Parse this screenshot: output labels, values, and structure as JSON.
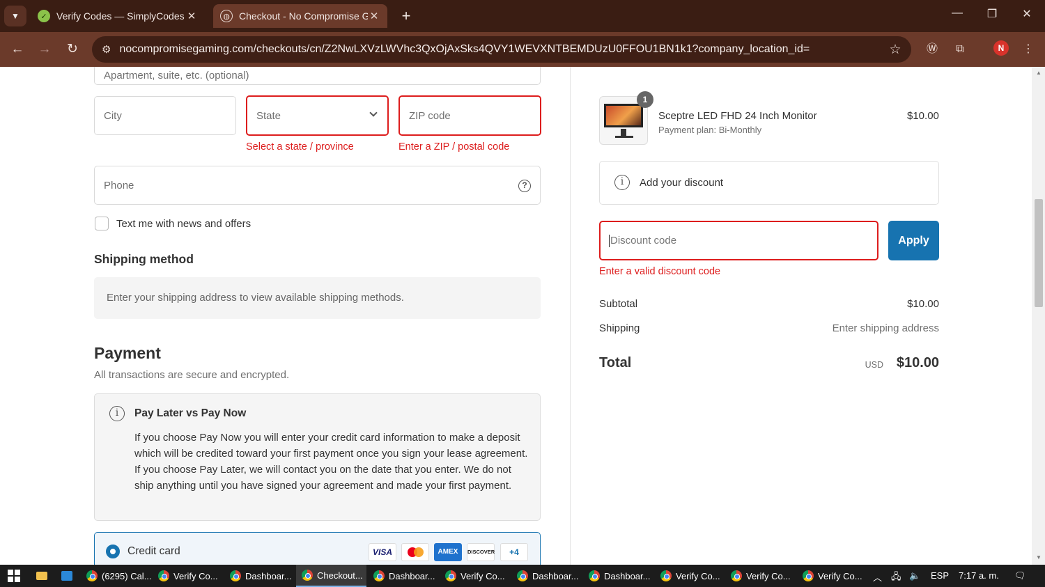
{
  "browser": {
    "tabs": [
      {
        "title": "Verify Codes — SimplyCodes",
        "active": false
      },
      {
        "title": "Checkout - No Compromise Gaming",
        "active": true
      }
    ],
    "url": "nocompromisegaming.com/checkouts/cn/Z2NwLXVzLWVhc3QxOjAxSks4QVY1WEVXNTBEMDUzU0FFOU1BN1k1?company_location_id=",
    "profile_initial": "N"
  },
  "form": {
    "apartment_placeholder": "Apartment, suite, etc. (optional)",
    "city_placeholder": "City",
    "state_placeholder": "State",
    "state_error": "Select a state / province",
    "zip_placeholder": "ZIP code",
    "zip_error": "Enter a ZIP / postal code",
    "phone_placeholder": "Phone",
    "text_offers_label": "Text me with news and offers",
    "shipping_heading": "Shipping method",
    "shipping_notice": "Enter your shipping address to view available shipping methods."
  },
  "payment": {
    "heading": "Payment",
    "subheading": "All transactions are secure and encrypted.",
    "info_title": "Pay Later vs Pay Now",
    "info_body": "If you choose Pay Now you will enter your credit card information to make a deposit which will be credited toward your first payment once you sign your lease agreement. If you choose Pay Later, we will contact you on the date that you enter. We do not ship anything until you have signed your agreement and made your first payment.",
    "credit_card_label": "Credit card",
    "card_brands": [
      "VISA",
      "",
      "AMEX",
      "DISCOVER"
    ],
    "more_cards": "+4"
  },
  "summary": {
    "product_name": "Sceptre LED FHD 24 Inch Monitor",
    "product_plan": "Payment plan: Bi-Monthly",
    "product_price": "$10.00",
    "quantity": "1",
    "discount_toggle": "Add your discount",
    "discount_placeholder": "Discount code",
    "apply_label": "Apply",
    "discount_error": "Enter a valid discount code",
    "subtotal_label": "Subtotal",
    "subtotal_value": "$10.00",
    "shipping_label": "Shipping",
    "shipping_value": "Enter shipping address",
    "total_label": "Total",
    "currency": "USD",
    "total_value": "$10.00"
  },
  "taskbar": {
    "tasks": [
      "(6295) Cal...",
      "Verify Co...",
      "Dashboar...",
      "Checkout...",
      "Dashboar...",
      "Verify Co...",
      "Dashboar...",
      "Dashboar...",
      "Verify Co...",
      "Verify Co...",
      "Verify Co..."
    ],
    "lang": "ESP",
    "time": "7:17 a. m."
  },
  "colors": {
    "accent": "#1773b0",
    "error": "#dd1d1d",
    "chrome": "#6b3a2a"
  }
}
